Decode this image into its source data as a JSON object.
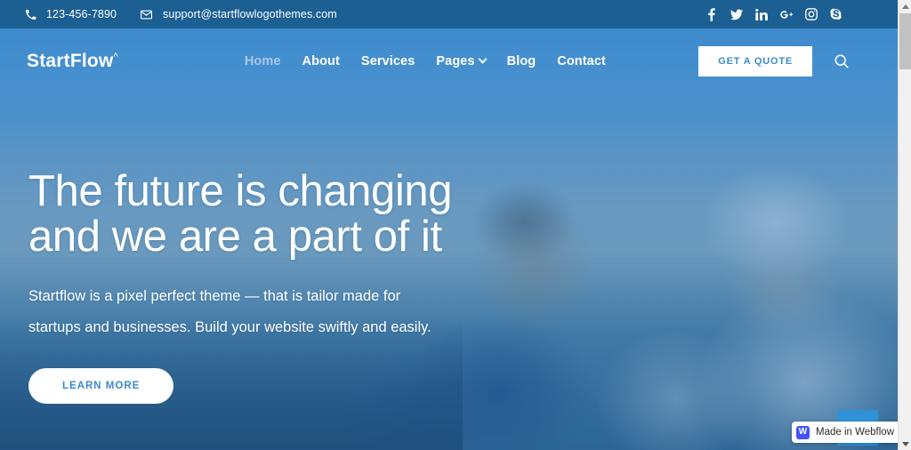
{
  "topbar": {
    "phone": "123-456-7890",
    "email": "support@startflowlogothemes.com",
    "phone_icon": "phone-icon",
    "email_icon": "envelope-icon",
    "social": [
      {
        "name": "facebook-icon",
        "label": "f"
      },
      {
        "name": "twitter-icon",
        "label": "t"
      },
      {
        "name": "linkedin-icon",
        "label": "in"
      },
      {
        "name": "google-plus-icon",
        "label": "G+"
      },
      {
        "name": "instagram-icon",
        "label": "ig"
      },
      {
        "name": "skype-icon",
        "label": "S"
      }
    ],
    "background_color": "#1b5f93"
  },
  "nav": {
    "logo": "StartFlow",
    "logo_mark": "^",
    "links": [
      {
        "label": "Home",
        "active": true
      },
      {
        "label": "About",
        "active": false
      },
      {
        "label": "Services",
        "active": false
      },
      {
        "label": "Pages",
        "active": false,
        "has_dropdown": true
      },
      {
        "label": "Blog",
        "active": false
      },
      {
        "label": "Contact",
        "active": false
      }
    ],
    "quote_button": "GET A QUOTE",
    "search_icon": "search-icon",
    "background_color": "#3b8ace",
    "accent_color": "#3b8ace"
  },
  "hero": {
    "title_line1": "The future is changing",
    "title_line2": "and we are a part of it",
    "subtitle_line1": "Startflow is a pixel perfect theme — that is tailor made for",
    "subtitle_line2": "startups and businesses. Build your website swiftly and easily.",
    "cta": "LEARN MORE",
    "overlay_color": "#3b8ace"
  },
  "webflow_badge": {
    "mark": "W",
    "text": "Made in Webflow",
    "mark_color": "#4353ff"
  },
  "scrollbar": {
    "up_arrow": "scroll-up-arrow",
    "down_arrow": "scroll-down-arrow",
    "thumb": "scrollbar-thumb"
  }
}
